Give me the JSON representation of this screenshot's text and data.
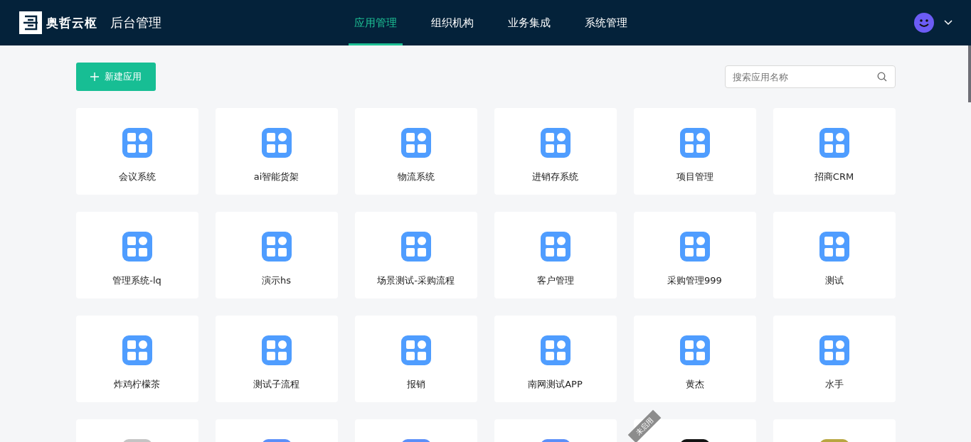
{
  "header": {
    "brand": "奥哲云枢",
    "title": "后台管理",
    "nav": [
      {
        "label": "应用管理",
        "selected": true
      },
      {
        "label": "组织机构",
        "selected": false
      },
      {
        "label": "业务集成",
        "selected": false
      },
      {
        "label": "系统管理",
        "selected": false
      }
    ]
  },
  "toolbar": {
    "new_button": "新建应用",
    "search": {
      "placeholder": "搜索应用名称"
    }
  },
  "apps": [
    {
      "name": "会议系统",
      "color": "#4f9dff"
    },
    {
      "name": "ai智能货架",
      "color": "#4f9dff"
    },
    {
      "name": "物流系统",
      "color": "#4f9dff"
    },
    {
      "name": "进销存系统",
      "color": "#4f9dff"
    },
    {
      "name": "项目管理",
      "color": "#4f9dff"
    },
    {
      "name": "招商CRM",
      "color": "#4f9dff"
    },
    {
      "name": "管理系统-lq",
      "color": "#4f9dff"
    },
    {
      "name": "演示hs",
      "color": "#4f9dff"
    },
    {
      "name": "场景测试-采购流程",
      "color": "#4f9dff"
    },
    {
      "name": "客户管理",
      "color": "#4f9dff"
    },
    {
      "name": "采购管理999",
      "color": "#4f9dff"
    },
    {
      "name": "测试",
      "color": "#4f9dff"
    },
    {
      "name": "炸鸡柠檬茶",
      "color": "#4f9dff"
    },
    {
      "name": "测试子流程",
      "color": "#4f9dff"
    },
    {
      "name": "报销",
      "color": "#4f9dff"
    },
    {
      "name": "南网测试APP",
      "color": "#4f9dff"
    },
    {
      "name": "黄杰",
      "color": "#4f9dff"
    },
    {
      "name": "水手",
      "color": "#4f9dff"
    },
    {
      "color": "#c4c4c4"
    },
    {
      "color": "#5b8ff9"
    },
    {
      "color": "#5b8ff9"
    },
    {
      "color": "#5b8ff9"
    },
    {
      "color": "#141414",
      "ribbon": "未启用"
    },
    {
      "color": "#b8a640"
    }
  ]
}
